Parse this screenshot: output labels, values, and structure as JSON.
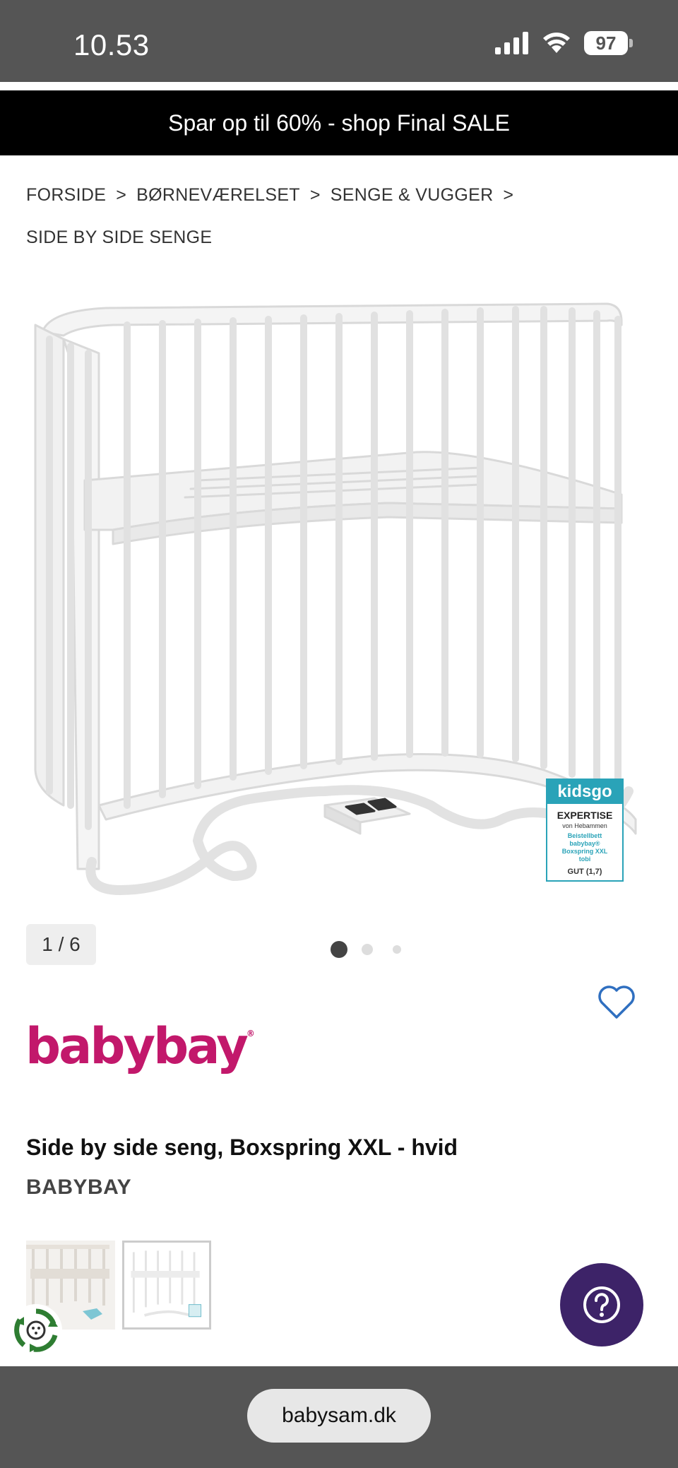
{
  "status_bar": {
    "time": "10.53",
    "battery": "97",
    "icons": [
      "signal-icon",
      "wifi-icon",
      "battery-icon"
    ]
  },
  "promo_banner": "Spar op til 60% - shop Final SALE",
  "breadcrumb": {
    "items": [
      "FORSIDE",
      "BØRNEVÆRELSET",
      "SENGE & VUGGER",
      "SIDE BY SIDE SENGE"
    ],
    "separator": ">"
  },
  "gallery": {
    "counter": "1 / 6",
    "dots_count": 3,
    "active_dot": 1
  },
  "badge": {
    "brand": "kidsgo",
    "title": "EXPERTISE",
    "sub": "von Hebammen",
    "body_lines": [
      "Beistellbett",
      "babybay®",
      "Boxspring XXL",
      "tobi"
    ],
    "grade": "GUT (1,7)"
  },
  "brand_logo": {
    "text": "babybay",
    "color": "#c2186b"
  },
  "product": {
    "title": "Side by side seng, Boxspring XXL - hvid",
    "brand": "BABYBAY"
  },
  "help": {
    "icon": "question-icon",
    "color": "#3d2368"
  },
  "browser": {
    "url": "babysam.dk"
  }
}
